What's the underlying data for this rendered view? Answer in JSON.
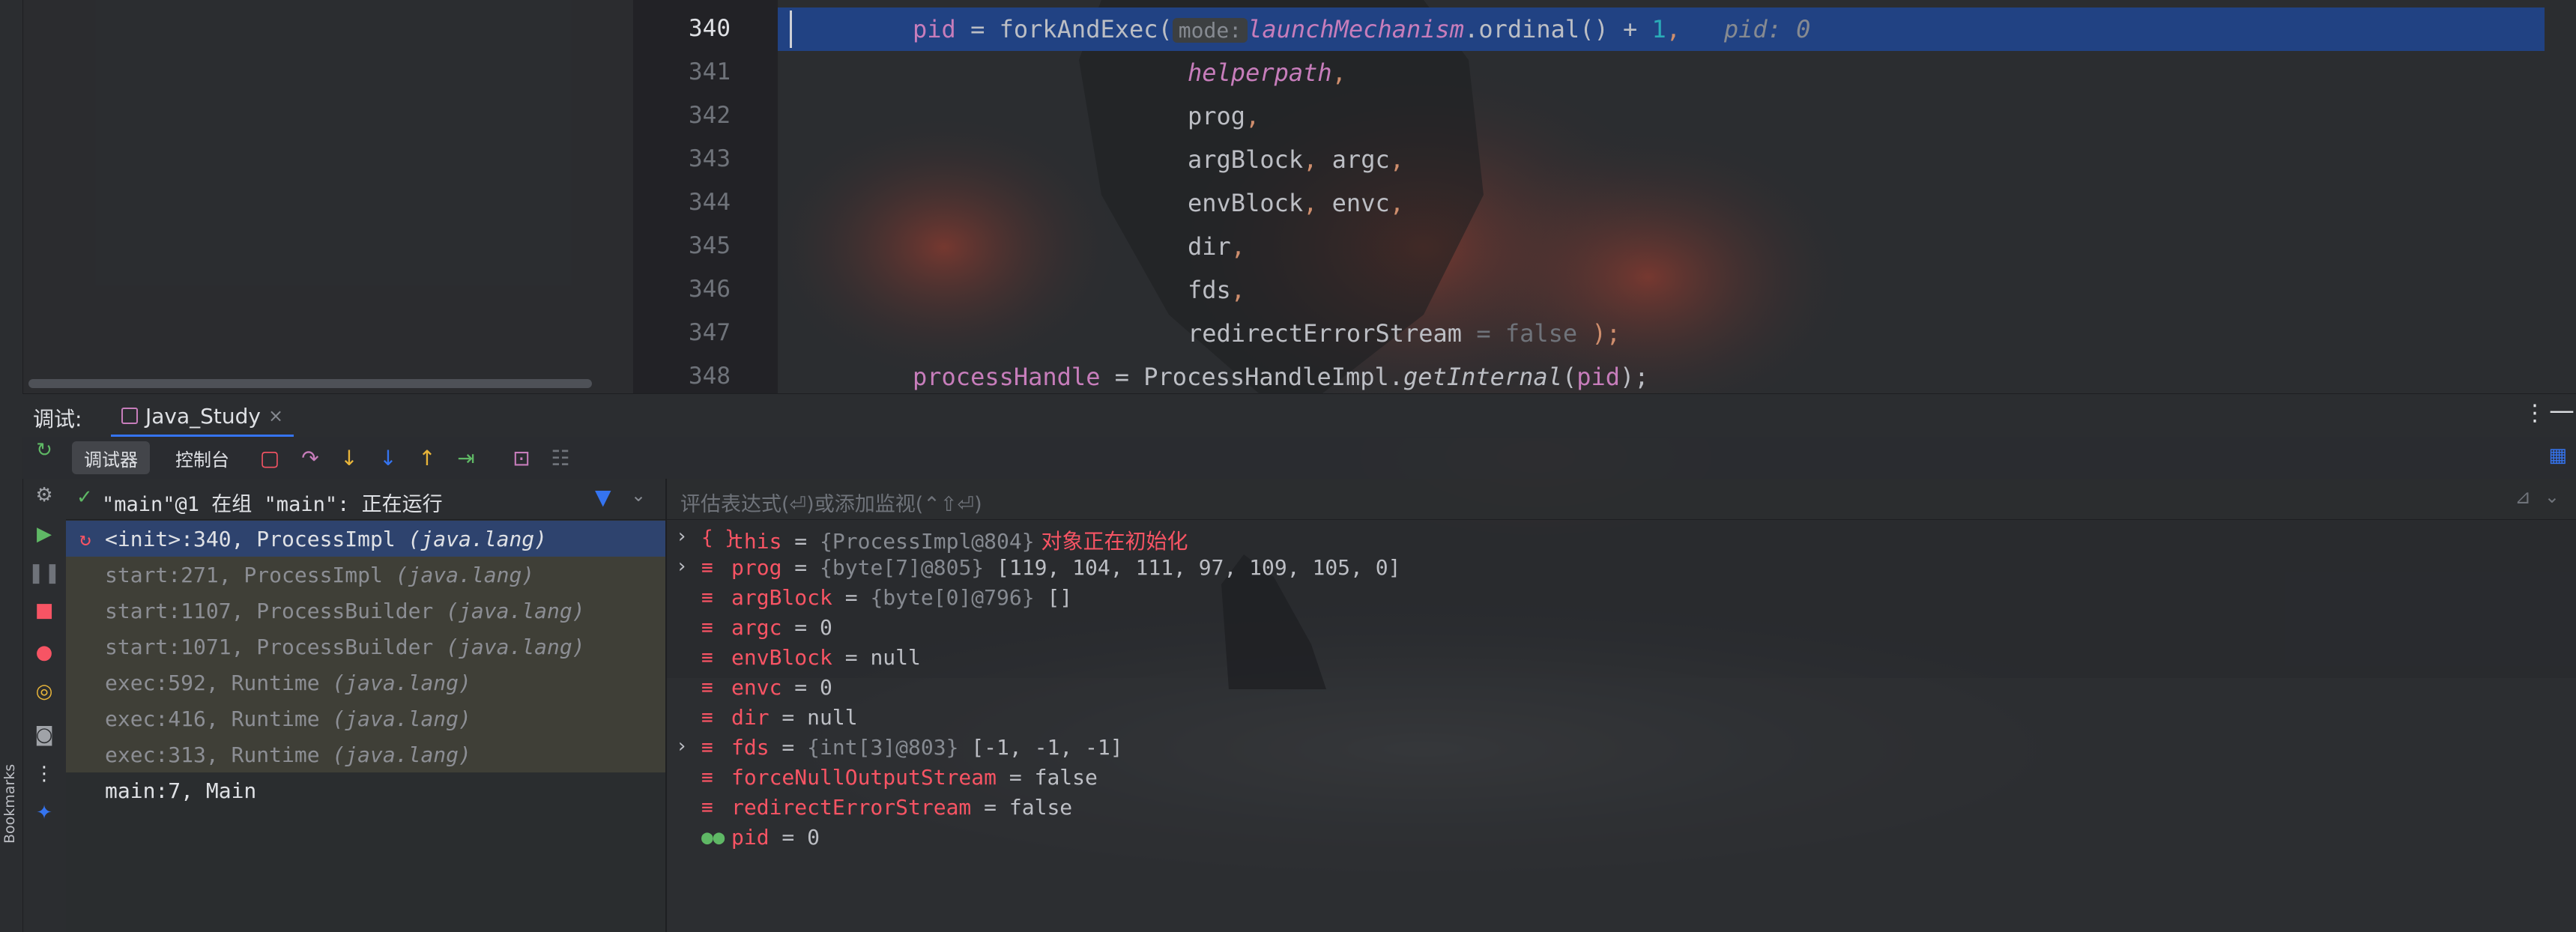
{
  "editor": {
    "lines": [
      {
        "no": "340",
        "current": true
      },
      {
        "no": "341"
      },
      {
        "no": "342"
      },
      {
        "no": "343"
      },
      {
        "no": "344"
      },
      {
        "no": "345"
      },
      {
        "no": "346"
      },
      {
        "no": "347"
      },
      {
        "no": "348"
      }
    ],
    "code": {
      "l340_var": "pid",
      "l340_eq": " = ",
      "l340_call": "forkAndExec(",
      "l340_hint": "mode:",
      "l340_arg": "launchMechanism",
      "l340_rest": ".ordinal() + ",
      "l340_num": "1",
      "l340_comma": ",",
      "l340_inline": "pid: 0",
      "l341": "helperpath",
      "l342": "prog",
      "l343_a": "argBlock",
      "l343_b": "argc",
      "l344_a": "envBlock",
      "l344_b": "envc",
      "l345": "dir",
      "l346": "fds",
      "l347": "redirectErrorStream",
      "l347_hint": " = false",
      "l347_end": " );",
      "l348_var": "processHandle",
      "l348_eq": " = ProcessHandleImpl.",
      "l348_call": "getInternal",
      "l348_open": "(",
      "l348_arg": "pid",
      "l348_close": ");",
      "comma": ","
    }
  },
  "debug": {
    "title": "调试:",
    "run_tab": "Java_Study",
    "run_tab_close": "×",
    "menu": "⋮",
    "minimize": "—",
    "subtabs": {
      "debugger": "调试器",
      "console": "控制台"
    },
    "thread": {
      "check": "✓",
      "label": "\"main\"@1 在组 \"main\": 正在运行"
    },
    "frames": [
      {
        "method": "<init>:340, ProcessImpl ",
        "pkg": "(java.lang)",
        "kind": "selected"
      },
      {
        "method": "start:271, ProcessImpl ",
        "pkg": "(java.lang)",
        "kind": "library"
      },
      {
        "method": "start:1107, ProcessBuilder ",
        "pkg": "(java.lang)",
        "kind": "library"
      },
      {
        "method": "start:1071, ProcessBuilder ",
        "pkg": "(java.lang)",
        "kind": "library"
      },
      {
        "method": "exec:592, Runtime ",
        "pkg": "(java.lang)",
        "kind": "library"
      },
      {
        "method": "exec:416, Runtime ",
        "pkg": "(java.lang)",
        "kind": "library"
      },
      {
        "method": "exec:313, Runtime ",
        "pkg": "(java.lang)",
        "kind": "library"
      },
      {
        "method": "main:7, Main",
        "pkg": "",
        "kind": "user"
      }
    ],
    "eval_placeholder": "评估表达式(⏎)或添加监视(⌃⇧⏎)",
    "variables": [
      {
        "expand": "›",
        "icon": "{ }",
        "name": "this",
        "eq": " = ",
        "type": "{ProcessImpl@804}",
        "value": "",
        "note": " 对象正在初始化",
        "icon_class": "icon-field"
      },
      {
        "expand": "›",
        "icon": "≡",
        "name": "prog",
        "eq": " = ",
        "type": "{byte[7]@805}",
        "value": " [119, 104, 111, 97, 109, 105, 0]",
        "note": "",
        "icon_class": "icon-field"
      },
      {
        "expand": "",
        "icon": "≡",
        "name": "argBlock",
        "eq": " = ",
        "type": "{byte[0]@796}",
        "value": " []",
        "note": "",
        "icon_class": "icon-field"
      },
      {
        "expand": "",
        "icon": "≡",
        "name": "argc",
        "eq": " = ",
        "type": "",
        "value": "0",
        "note": "",
        "icon_class": "icon-field"
      },
      {
        "expand": "",
        "icon": "≡",
        "name": "envBlock",
        "eq": " = ",
        "type": "",
        "value": "null",
        "note": "",
        "icon_class": "icon-field"
      },
      {
        "expand": "",
        "icon": "≡",
        "name": "envc",
        "eq": " = ",
        "type": "",
        "value": "0",
        "note": "",
        "icon_class": "icon-field"
      },
      {
        "expand": "",
        "icon": "≡",
        "name": "dir",
        "eq": " = ",
        "type": "",
        "value": "null",
        "note": "",
        "icon_class": "icon-field"
      },
      {
        "expand": "›",
        "icon": "≡",
        "name": "fds",
        "eq": " = ",
        "type": "{int[3]@803}",
        "value": " [-1, -1, -1]",
        "note": "",
        "icon_class": "icon-field"
      },
      {
        "expand": "",
        "icon": "≡",
        "name": "forceNullOutputStream",
        "eq": " = ",
        "type": "",
        "value": "false",
        "note": "",
        "icon_class": "icon-field"
      },
      {
        "expand": "",
        "icon": "≡",
        "name": "redirectErrorStream",
        "eq": " = ",
        "type": "",
        "value": "false",
        "note": "",
        "icon_class": "icon-field"
      },
      {
        "expand": "",
        "icon": "●●",
        "name": "pid",
        "eq": " = ",
        "type": "",
        "value": "0",
        "note": "",
        "icon_class": "icon-watch"
      }
    ]
  },
  "sidebar": {
    "bookmarks_label": "Bookmarks"
  },
  "colors": {
    "accent": "#3574f0",
    "error": "#f75464",
    "ok": "#5fb865",
    "selection": "#214283"
  }
}
